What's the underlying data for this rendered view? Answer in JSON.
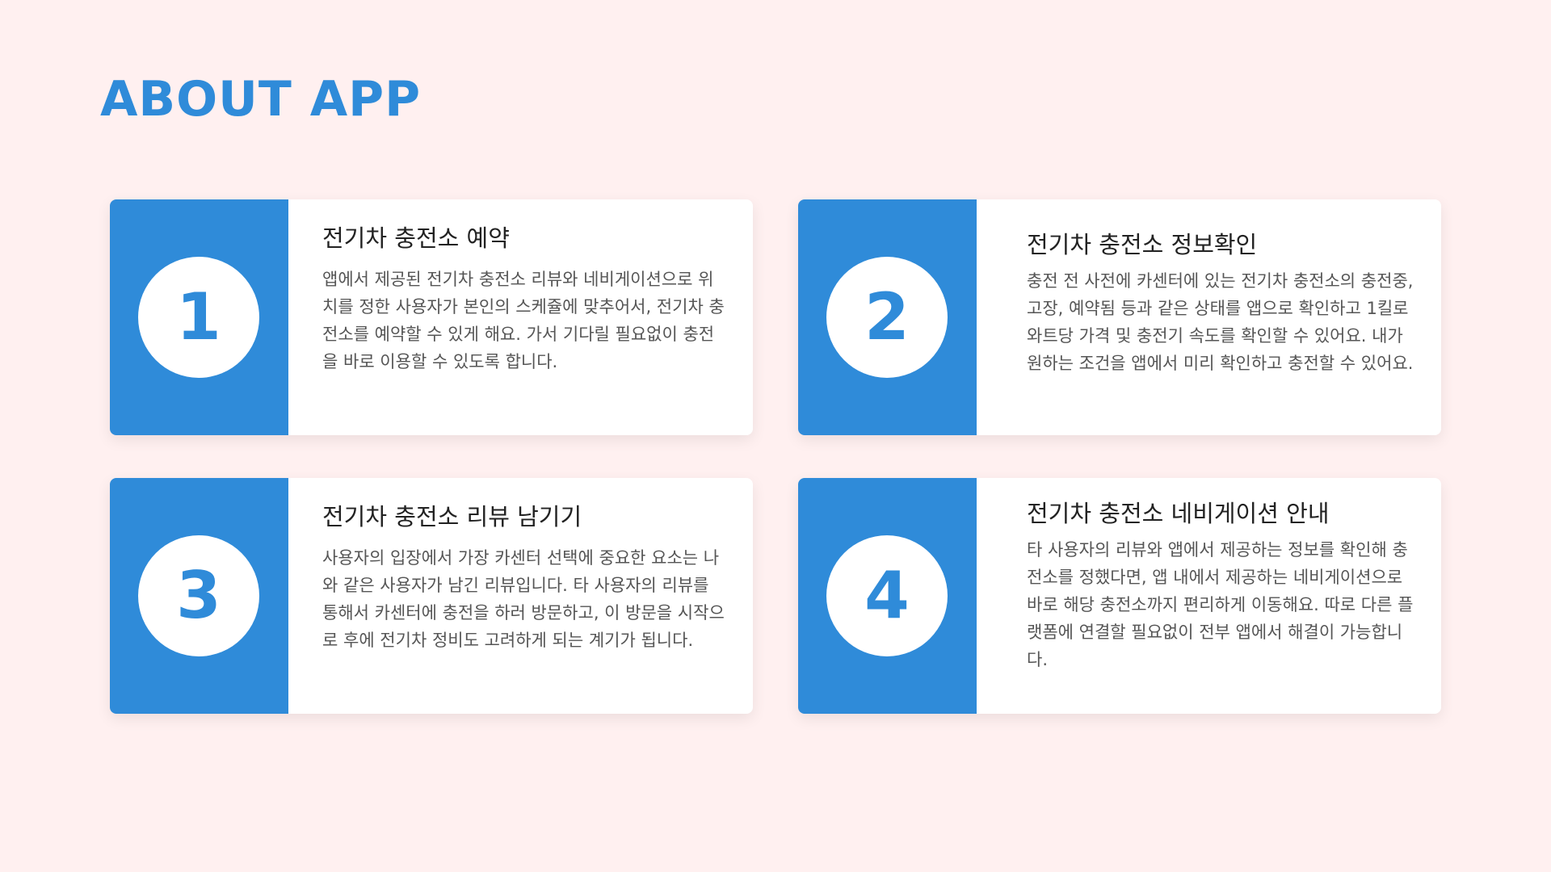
{
  "page": {
    "title": "ABOUT APP",
    "accent_color": "#2f8bd9",
    "background_color": "#fff0f0"
  },
  "cards": [
    {
      "number": "1",
      "title": "전기차 충전소 예약",
      "text": "앱에서 제공된 전기차 충전소 리뷰와 네비게이션으로 위치를 정한 사용자가 본인의 스케쥴에 맞추어서, 전기차 충전소를 예약할 수 있게 해요. 가서 기다릴 필요없이 충전을 바로 이용할 수 있도록 합니다."
    },
    {
      "number": "2",
      "title": "전기차 충전소 정보확인",
      "text": "충전 전 사전에 카센터에 있는 전기차 충전소의 충전중, 고장, 예약됨 등과 같은 상태를 앱으로 확인하고 1킬로 와트당 가격 및 충전기 속도를 확인할 수 있어요. 내가 원하는 조건을 앱에서 미리 확인하고 충전할 수 있어요."
    },
    {
      "number": "3",
      "title": "전기차 충전소 리뷰 남기기",
      "text": "사용자의 입장에서 가장 카센터 선택에 중요한 요소는 나와 같은 사용자가 남긴 리뷰입니다. 타 사용자의 리뷰를 통해서 카센터에 충전을 하러 방문하고, 이 방문을 시작으로 후에 전기차 정비도 고려하게 되는 계기가 됩니다."
    },
    {
      "number": "4",
      "title": "전기차 충전소 네비게이션 안내",
      "text": "타 사용자의 리뷰와 앱에서 제공하는 정보를 확인해 충전소를 정했다면, 앱 내에서 제공하는 네비게이션으로 바로 해당 충전소까지 편리하게 이동해요. 따로 다른 플랫폼에 연결할 필요없이 전부 앱에서 해결이 가능합니다."
    }
  ]
}
